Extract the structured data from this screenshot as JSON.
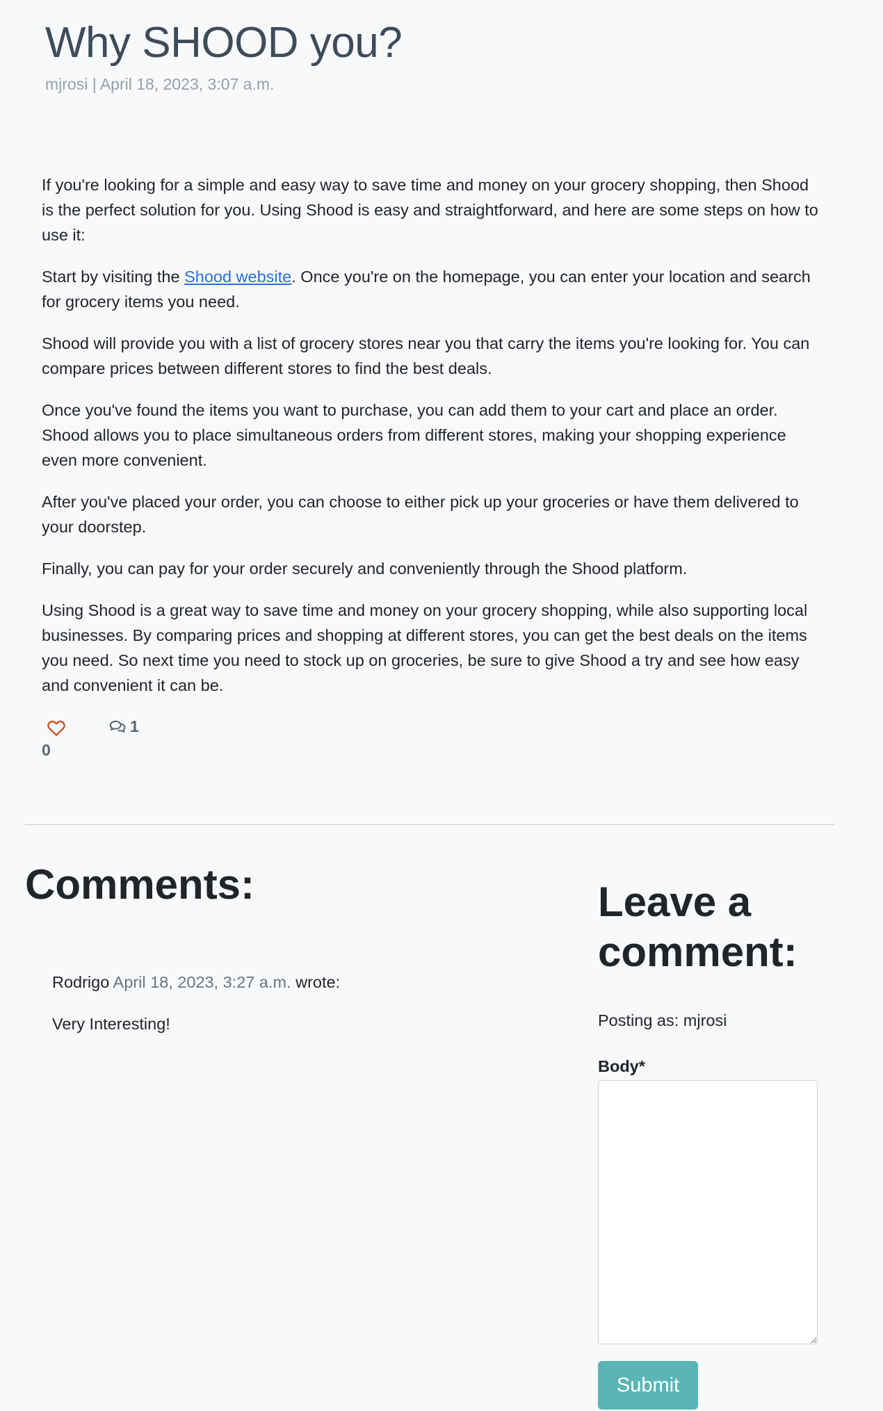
{
  "post": {
    "title": "Why SHOOD you?",
    "meta": "mjrosi | April 18, 2023, 3:07 a.m.",
    "paragraphs": {
      "p1": "If you're looking for a simple and easy way to save time and money on your grocery shopping, then Shood is the perfect solution for you. Using Shood is easy and straightforward, and here are some steps on how to use it:",
      "p2_before": "Start by visiting the ",
      "p2_link": "Shood website",
      "p2_after": ". Once you're on the homepage, you can enter your location and search for grocery items you need.",
      "p3": "Shood will provide you with a list of grocery stores near you that carry the items you're looking for. You can compare prices between different stores to find the best deals.",
      "p4": "Once you've found the items you want to purchase, you can add them to your cart and place an order. Shood allows you to place simultaneous orders from different stores, making your shopping experience even more convenient.",
      "p5": "After you've placed your order, you can choose to either pick up your groceries or have them delivered to your doorstep.",
      "p6": "Finally, you can pay for your order securely and conveniently through the Shood platform.",
      "p7": "Using Shood is a great way to save time and money on your grocery shopping, while also supporting local businesses. By comparing prices and shopping at different stores, you can get the best deals on the items you need. So next time you need to stock up on groceries, be sure to give Shood a try and see how easy and convenient it can be."
    },
    "like_count": "0",
    "comment_count": "1"
  },
  "comments_section": {
    "heading": "Comments:",
    "items": [
      {
        "author": "Rodrigo",
        "date": "April 18, 2023, 3:27 a.m.",
        "wrote": "wrote:",
        "body": "Very Interesting!"
      }
    ]
  },
  "comment_form": {
    "heading": "Leave a comment:",
    "posting_as": "Posting as: mjrosi",
    "body_label": "Body*",
    "body_value": "",
    "submit_label": "Submit"
  },
  "icons": {
    "like": "heart-outline-icon",
    "comments": "speech-bubbles-icon"
  },
  "colors": {
    "heart": "#c9552b",
    "link": "#2a6fd8",
    "submit": "#5bb5b5"
  }
}
